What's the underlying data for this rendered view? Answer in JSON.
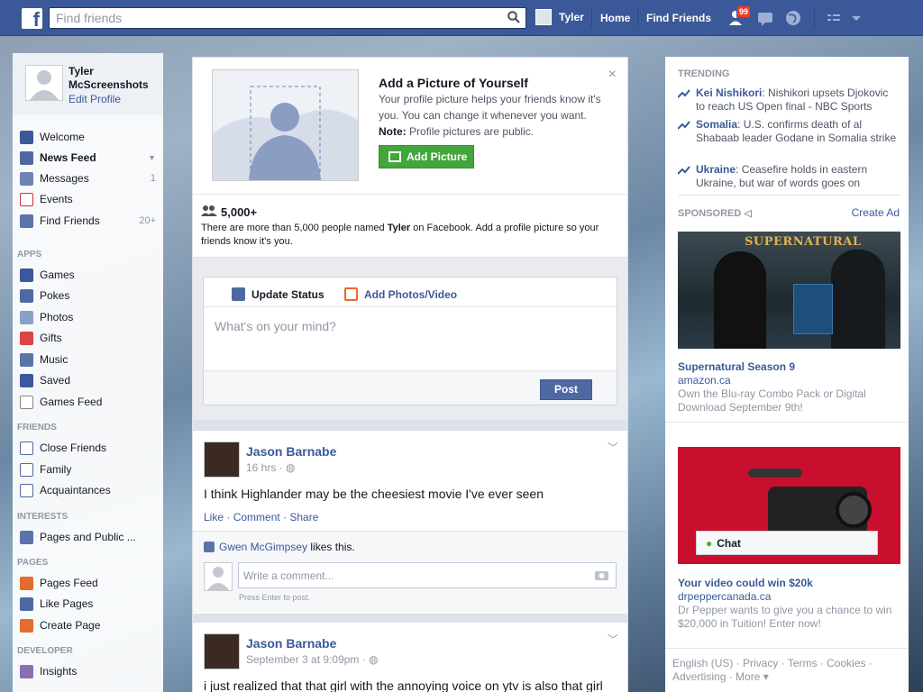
{
  "topbar": {
    "logo": "f",
    "search_placeholder": "Find friends",
    "user_name": "Tyler",
    "home": "Home",
    "find_friends": "Find Friends",
    "friend_requests_badge": "99",
    "brand_color": "#3b5998"
  },
  "leftnav": {
    "profile_name": "Tyler McScreenshots",
    "edit_profile": "Edit Profile",
    "main": [
      {
        "label": "Welcome",
        "icon": "facebook-icon",
        "count": ""
      },
      {
        "label": "News Feed",
        "icon": "news-feed-icon",
        "count": ""
      },
      {
        "label": "Messages",
        "icon": "messages-icon",
        "count": "1"
      },
      {
        "label": "Events",
        "icon": "events-icon",
        "count": ""
      },
      {
        "label": "Find Friends",
        "icon": "find-friends-icon",
        "count": "20+"
      }
    ],
    "apps_header": "APPS",
    "apps": [
      {
        "label": "Games",
        "icon": "games-icon"
      },
      {
        "label": "Pokes",
        "icon": "pokes-icon"
      },
      {
        "label": "Photos",
        "icon": "photos-icon"
      },
      {
        "label": "Gifts",
        "icon": "gifts-icon"
      },
      {
        "label": "Music",
        "icon": "music-icon"
      },
      {
        "label": "Saved",
        "icon": "saved-icon"
      },
      {
        "label": "Games Feed",
        "icon": "games-feed-icon"
      }
    ],
    "friends_header": "FRIENDS",
    "friends": [
      {
        "label": "Close Friends",
        "icon": "close-friends-icon"
      },
      {
        "label": "Family",
        "icon": "family-icon"
      },
      {
        "label": "Acquaintances",
        "icon": "acquaintances-icon"
      }
    ],
    "interests_header": "INTERESTS",
    "interests": [
      {
        "label": "Pages and Public ...",
        "icon": "pages-public-icon"
      }
    ],
    "pages_header": "PAGES",
    "pages": [
      {
        "label": "Pages Feed",
        "icon": "pages-feed-icon"
      },
      {
        "label": "Like Pages",
        "icon": "like-pages-icon"
      },
      {
        "label": "Create Page",
        "icon": "create-page-icon"
      }
    ],
    "developer_header": "DEVELOPER",
    "developer": [
      {
        "label": "Insights",
        "icon": "insights-icon"
      }
    ]
  },
  "profile_prompt": {
    "title": "Add a Picture of Yourself",
    "text": "Your profile picture helps your friends know it's you. You can change it whenever you want.",
    "note_label": "Note:",
    "note_text": "Profile pictures are public.",
    "button": "Add Picture",
    "close": "×"
  },
  "name_stat": {
    "count": "5,000+",
    "text_before": "There are more than 5,000 people named",
    "name": "Tyler",
    "text_after": "on Facebook. Add a profile picture so your friends know it's you."
  },
  "composer": {
    "tab_status": "Update Status",
    "tab_photos": "Add Photos/Video",
    "placeholder": "What's on your mind?",
    "post_button": "Post"
  },
  "posts": [
    {
      "author": "Jason Barnabe",
      "time": "16 hrs",
      "text": "I think Highlander may be the cheesiest movie I've ever seen",
      "actions": [
        "Like",
        "Comment",
        "Share"
      ],
      "liker": "Gwen McGimpsey",
      "likes_suffix": "likes this.",
      "comment_placeholder": "Write a comment...",
      "press_enter": "Press Enter to post."
    },
    {
      "author": "Jason Barnabe",
      "time": "September 3 at 9:09pm",
      "text": "i just realized that that girl with the annoying voice on ytv is also that girl"
    }
  ],
  "right": {
    "trending_header": "TRENDING",
    "trending": [
      {
        "topic": "Kei Nishikori",
        "text": ": Nishikori upsets Djokovic to reach US Open final - NBC Sports"
      },
      {
        "topic": "Somalia",
        "text": ": U.S. confirms death of al Shabaab leader Godane in Somalia strike"
      },
      {
        "topic": "Ukraine",
        "text": ": Ceasefire holds in eastern Ukraine, but war of words goes on"
      }
    ],
    "sponsored_header": "SPONSORED",
    "create_ad": "Create Ad",
    "ads": [
      {
        "image_text": "SUPERNATURAL",
        "title": "Supernatural Season 9",
        "url": "amazon.ca",
        "desc": "Own the Blu-ray Combo Pack or Digital Download September 9th!"
      },
      {
        "title": "Your video could win $20k",
        "url": "drpeppercanada.ca",
        "desc": "Dr Pepper wants to give you a chance to win $20,000 in Tuition! Enter now!"
      }
    ],
    "chat": "Chat",
    "footer": "English (US) · Privacy · Terms · Cookies · Advertising · More ▾"
  }
}
